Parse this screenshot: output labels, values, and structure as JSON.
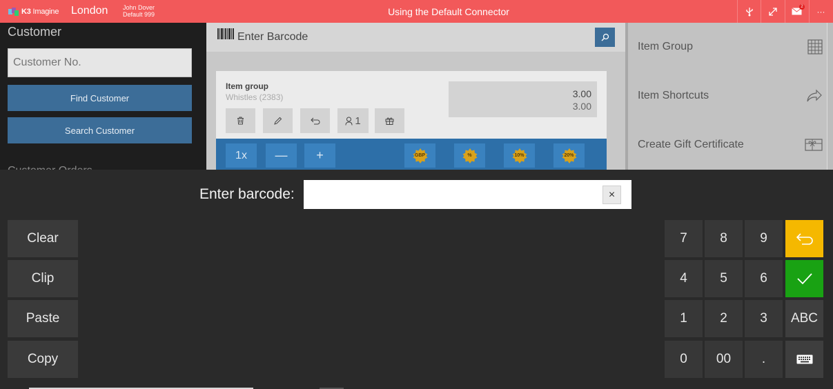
{
  "topbar": {
    "brand": "K3",
    "brand_sub": "Imagine",
    "location": "London",
    "user_name": "John Dover",
    "user_default": "Default 999",
    "title": "Using the Default Connector",
    "mail_count": "2",
    "more": "···",
    "accent": "#f2595a"
  },
  "customer": {
    "title": "Customer",
    "customer_no_placeholder": "Customer No.",
    "find_label": "Find Customer",
    "search_label": "Search Customer",
    "cut_text": "Customer Orders"
  },
  "barcode_bar": {
    "label": "Enter Barcode"
  },
  "item_card": {
    "group_label": "Item group",
    "group_sub": "Whistles (2383)",
    "qty_top": "3.00",
    "qty_bottom": "3.00",
    "user_count": "1"
  },
  "action_strip": {
    "qty_label": "1x",
    "minus": "—",
    "plus": "+",
    "discounts": [
      "GBP",
      "%",
      "10%",
      "20%"
    ]
  },
  "right_menu": {
    "items": [
      {
        "label": "Item Group",
        "icon": "grid-icon"
      },
      {
        "label": "Item Shortcuts",
        "icon": "share-arrow-icon"
      },
      {
        "label": "Create Gift Certificate",
        "icon": "gift-card-icon"
      }
    ]
  },
  "overlay": {
    "prompt": "Enter barcode:",
    "input_value": "",
    "clear_icon": "×"
  },
  "side_buttons": [
    "Clear",
    "Clip",
    "Paste",
    "Copy"
  ],
  "keypad": {
    "k7": "7",
    "k8": "8",
    "k9": "9",
    "k4": "4",
    "k5": "5",
    "k6": "6",
    "k1": "1",
    "k2": "2",
    "k3": "3",
    "k0": "0",
    "k00": "00",
    "kdot": ".",
    "abc": "ABC",
    "back_color": "#f5b800",
    "ok_color": "#19a213"
  }
}
